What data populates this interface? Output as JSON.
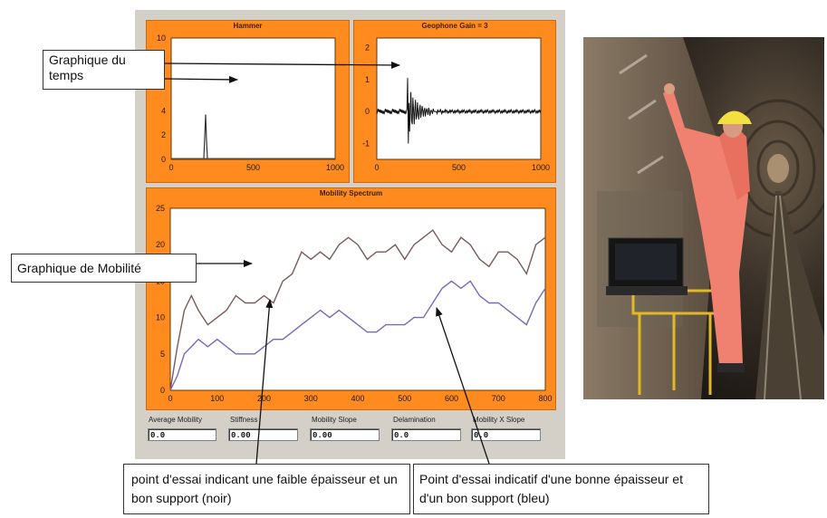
{
  "hammer_chart": {
    "title": "Hammer",
    "type": "line",
    "x_ticks": [
      "0",
      "500",
      "1000"
    ],
    "y_ticks": [
      "0",
      "2",
      "4",
      "10"
    ],
    "xlim": [
      0,
      1000
    ],
    "ylim": [
      0,
      10
    ],
    "impulse": {
      "x": 210,
      "peak": 3.7
    }
  },
  "geophone_chart": {
    "title": "Geophone Gain = 3",
    "type": "line",
    "x_ticks": [
      "0",
      "500",
      "1000"
    ],
    "y_ticks": [
      "2",
      "1",
      "0",
      "-1"
    ],
    "xlim": [
      0,
      1000
    ],
    "ylim": [
      -1.5,
      2.3
    ],
    "impulse": {
      "x": 190,
      "peak": 2.1,
      "trough": -1.0
    }
  },
  "mobility_chart": {
    "title": "Mobility Spectrum",
    "type": "line",
    "x_ticks": [
      "0",
      "100",
      "200",
      "300",
      "400",
      "500",
      "600",
      "700",
      "800"
    ],
    "y_ticks": [
      "0",
      "5",
      "10",
      "15",
      "20",
      "25"
    ],
    "xlim": [
      0,
      800
    ],
    "ylim": [
      0,
      25
    ],
    "series": [
      {
        "x": [
          0,
          15,
          30,
          45,
          60,
          80,
          100,
          120,
          140,
          160,
          180,
          200,
          220,
          240,
          260,
          280,
          300,
          320,
          340,
          360,
          380,
          400,
          420,
          440,
          460,
          480,
          500,
          520,
          540,
          560,
          580,
          600,
          620,
          640,
          660,
          680,
          700,
          720,
          740,
          760,
          780,
          800
        ],
        "values": [
          0,
          6,
          11,
          13,
          11,
          9,
          10,
          11,
          13,
          12,
          12,
          13,
          12,
          15,
          16,
          19,
          18,
          19,
          18,
          20,
          21,
          20,
          18,
          19,
          19,
          20,
          18,
          20,
          21,
          22,
          20,
          19,
          21,
          20,
          18,
          17,
          19,
          19,
          18,
          16,
          20,
          21
        ]
      },
      {
        "x": [
          0,
          15,
          30,
          45,
          60,
          80,
          100,
          120,
          140,
          160,
          180,
          200,
          220,
          240,
          260,
          280,
          300,
          320,
          340,
          360,
          380,
          400,
          420,
          440,
          460,
          480,
          500,
          520,
          540,
          560,
          580,
          600,
          620,
          640,
          660,
          680,
          700,
          720,
          740,
          760,
          780,
          800
        ],
        "values": [
          0,
          2,
          5,
          6,
          7,
          6,
          7,
          6,
          5,
          5,
          5,
          6,
          7,
          7,
          8,
          9,
          10,
          11,
          10,
          11,
          10,
          9,
          8,
          8,
          9,
          9,
          9,
          10,
          10,
          12,
          14,
          15,
          14,
          15,
          13,
          12,
          12,
          11,
          10,
          9,
          12,
          14
        ]
      }
    ]
  },
  "fields": [
    {
      "label": "Average Mobility",
      "value": "0.0"
    },
    {
      "label": "Stiffness",
      "value": "0.00"
    },
    {
      "label": "Mobility Slope",
      "value": "0.00"
    },
    {
      "label": "Delamination",
      "value": "0.0"
    },
    {
      "label": "Mobility X Slope",
      "value": "0.0"
    }
  ],
  "callouts": {
    "time_graph": "Graphique du temps",
    "mobility_graph": "Graphique de Mobilité",
    "low_thickness": "point d'essai indicant une faible épaisseur et un bon support (noir)",
    "good_thickness": "Point d'essai indicatif d'une bonne épaisseur et d'un bon support (bleu)"
  },
  "colors": {
    "frame": "#ff8a1e",
    "black_series": "#7a5a5a",
    "blue_series": "#7c66b8"
  }
}
